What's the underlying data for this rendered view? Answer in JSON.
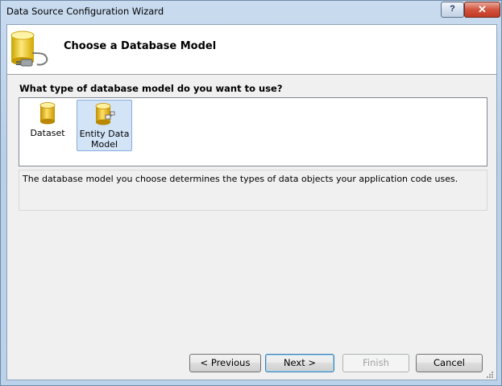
{
  "window": {
    "title": "Data Source Configuration Wizard",
    "help_label": "?",
    "close_label": "✕"
  },
  "header": {
    "title": "Choose a Database Model",
    "icon": "database-plug-icon"
  },
  "main": {
    "question": "What type of database model do you want to use?",
    "models": [
      {
        "label": "Dataset",
        "icon": "database-icon",
        "selected": false
      },
      {
        "label": "Entity Data Model",
        "icon": "entity-database-icon",
        "selected": true
      }
    ],
    "description": "The database model you choose determines the types of data objects your application code uses."
  },
  "buttons": {
    "previous": "< Previous",
    "next": "Next >",
    "finish": "Finish",
    "cancel": "Cancel"
  },
  "colors": {
    "selection": "#d3e4f7",
    "selection_border": "#84acdd",
    "close_red": "#c23a22"
  }
}
